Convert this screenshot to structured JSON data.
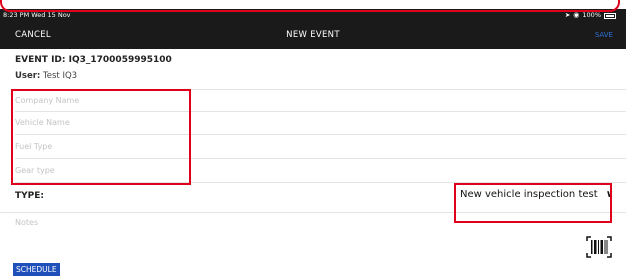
{
  "status_bar": {
    "time": "8:23 PM  Wed 15 Nov",
    "battery": "100%"
  },
  "nav": {
    "cancel_label": "CANCEL",
    "title": "NEW EVENT",
    "save_label": "SAVE"
  },
  "event": {
    "id_text": "EVENT ID: IQ3_1700059995100",
    "user_label": "User:",
    "user_name": "Test IQ3"
  },
  "fields": {
    "company_placeholder": "Company Name",
    "vehicle_placeholder": "Vehicle Name",
    "fuel_placeholder": "Fuel Type",
    "gear_placeholder": "Gear type"
  },
  "type": {
    "label": "TYPE:",
    "selected_value": "New vehicle inspection test"
  },
  "notes_placeholder": "Notes",
  "schedule_label": "SCHEDULE",
  "colors": {
    "nav_background": "#1a1a1a",
    "save_text": "#2f6fd6",
    "highlight_red": "#e0001b",
    "schedule_button": "#1f4fb8"
  },
  "icons": {
    "wifi": "wifi-icon",
    "battery": "battery-icon",
    "dropdown": "chevron-down-icon",
    "scanner": "barcode-icon"
  }
}
